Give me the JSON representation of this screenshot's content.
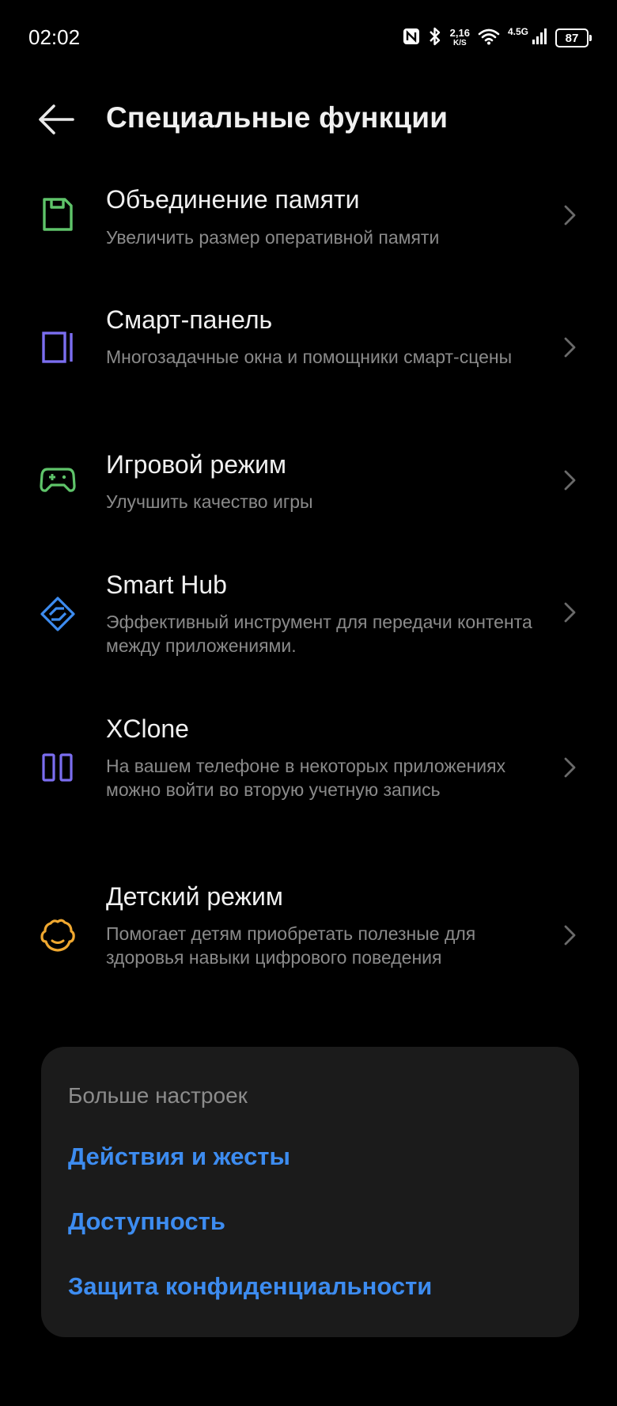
{
  "status_bar": {
    "time": "02:02",
    "speed_value": "2,16",
    "speed_unit": "K/S",
    "network_type": "4.5G",
    "battery": "87"
  },
  "header": {
    "title": "Специальные функции"
  },
  "items": [
    {
      "title": "Объединение памяти",
      "subtitle": "Увеличить размер оперативной памяти",
      "icon": "memory-card-icon",
      "icon_color": "#5fc46a"
    },
    {
      "title": "Смарт-панель",
      "subtitle": "Многозадачные окна и помощники смарт-сцены",
      "icon": "side-panel-icon",
      "icon_color": "#7b6ef0"
    },
    {
      "title": "Игровой режим",
      "subtitle": "Улучшить качество игры",
      "icon": "gamepad-icon",
      "icon_color": "#5fc46a"
    },
    {
      "title": "Smart Hub",
      "subtitle": "Эффективный инструмент для передачи контента между приложениями.",
      "icon": "smart-hub-icon",
      "icon_color": "#3d8cf0"
    },
    {
      "title": "XClone",
      "subtitle": "На вашем телефоне в некоторых приложениях можно войти во вторую учетную запись",
      "icon": "clone-icon",
      "icon_color": "#7b6ef0"
    },
    {
      "title": "Детский режим",
      "subtitle": "Помогает детям приобретать полезные для здоровья навыки цифрового поведения",
      "icon": "kid-face-icon",
      "icon_color": "#f0a830"
    }
  ],
  "more_settings": {
    "header": "Больше настроек",
    "links": [
      "Действия и жесты",
      "Доступность",
      "Защита конфиденциальности"
    ],
    "link_color": "#3d8cf0"
  }
}
